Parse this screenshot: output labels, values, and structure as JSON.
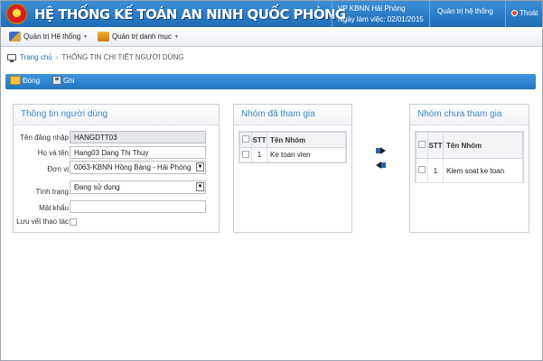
{
  "header": {
    "app_title": "HỆ THỐNG KẾ TOÁN AN NINH QUỐC PHÒNG",
    "office": "VP KBNN Hải Phòng",
    "workday": "Ngày làm việc: 02/01/2015",
    "admin": "Quản trị hệ thống",
    "logout": "Thoát"
  },
  "menu": {
    "items": [
      {
        "label": "Quản trị Hệ thống"
      },
      {
        "label": "Quản trị danh mục"
      }
    ]
  },
  "breadcrumb": {
    "home": "Trang chủ",
    "separator": "›",
    "current": "THÔNG TIN CHI TIẾT NGƯỜI DÙNG"
  },
  "toolbar": {
    "close_label": "Đóng",
    "save_label": "Ghi"
  },
  "user_info": {
    "title": "Thông tin người dùng",
    "username_label": "Tên đăng nhập",
    "username_value": "HANGDTT03",
    "fullname_label": "Họ và tên",
    "fullname_value": "Hang03 Dang Thi Thuy",
    "unit_label": "Đơn vị",
    "unit_value": "0063-KBNN Hồng Bàng - Hải Phòng",
    "status_label": "Tình trạng",
    "status_value": "Đang sử dụng",
    "password_label": "Mật khẩu",
    "password_value": "",
    "log_label": "Lưu vết thao tác",
    "log_checked": false
  },
  "joined_groups": {
    "title": "Nhóm đã tham gia",
    "columns": [
      "STT",
      "Tên Nhóm"
    ],
    "rows": [
      {
        "stt": "1",
        "name": "Ke toan vien"
      }
    ]
  },
  "available_groups": {
    "title": "Nhóm chưa tham gia",
    "columns": [
      "STT",
      "Tên Nhóm"
    ],
    "rows": [
      {
        "stt": "1",
        "name": "Kiem soat ke toan"
      }
    ]
  },
  "colors": {
    "header_blue": "#2a7cc6",
    "panel_title": "#3d87c9",
    "link": "#2c6fb0"
  }
}
